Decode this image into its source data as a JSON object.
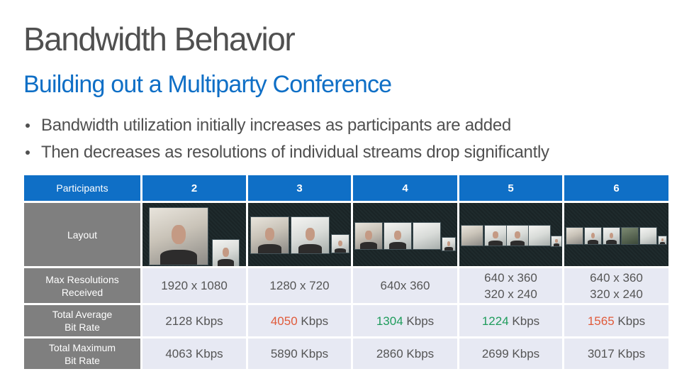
{
  "slide": {
    "title": "Bandwidth Behavior",
    "subtitle": "Building out a Multiparty Conference",
    "bullets": [
      "Bandwidth utilization initially increases as participants are added",
      "Then decreases as resolutions of individual streams drop significantly"
    ]
  },
  "table": {
    "header": {
      "label": "Participants",
      "columns": [
        "2",
        "3",
        "4",
        "5",
        "6"
      ]
    },
    "layout_row": {
      "label": "Layout",
      "screenshots": [
        "2-participant video conference layout screenshot",
        "3-participant video conference layout screenshot",
        "4-participant video conference layout screenshot",
        "5-participant video conference layout screenshot",
        "6-participant video conference layout screenshot"
      ]
    },
    "resolution_row": {
      "label_line1": "Max Resolutions",
      "label_line2": "Received",
      "values": [
        {
          "line1": "1920 x 1080",
          "line2": ""
        },
        {
          "line1": "1280 x 720",
          "line2": ""
        },
        {
          "line1": "640x 360",
          "line2": ""
        },
        {
          "line1": "640 x 360",
          "line2": "320 x 240"
        },
        {
          "line1": "640 x 360",
          "line2": "320 x 240"
        }
      ]
    },
    "avg_row": {
      "label_line1": "Total Average",
      "label_line2": "Bit Rate",
      "unit": "Kbps",
      "values": [
        {
          "number": "2128",
          "highlight": "none"
        },
        {
          "number": "4050",
          "highlight": "red"
        },
        {
          "number": "1304",
          "highlight": "green"
        },
        {
          "number": "1224",
          "highlight": "green"
        },
        {
          "number": "1565",
          "highlight": "red"
        }
      ]
    },
    "max_row": {
      "label_line1": "Total Maximum",
      "label_line2": "Bit Rate",
      "unit": "Kbps",
      "values": [
        "4063",
        "5890",
        "2860",
        "2699",
        "3017"
      ]
    }
  },
  "colors": {
    "header_blue": "#0f6fc6",
    "label_gray": "#7f7f7f",
    "value_bg": "#e7e9f3",
    "increase_red": "#e05a3a",
    "decrease_green": "#1f9c5c"
  }
}
